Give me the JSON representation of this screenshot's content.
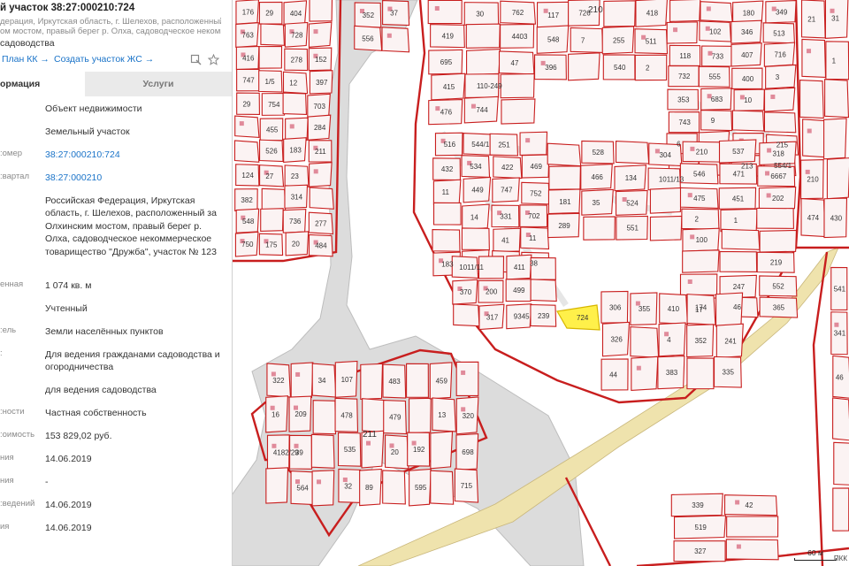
{
  "panel": {
    "title": "й участок 38:27:000210:724",
    "address_lines": [
      "дерация, Иркутская область, г. Шелехов, расположенный за",
      "ом мостом, правый берег р. Олха, садоводческое некоммерческ..."
    ],
    "type_line": "садоводства",
    "links": {
      "plan": "План КК →",
      "create": "Создать участок ЖС →"
    },
    "icons": {
      "bookmark": "bookmark-icon",
      "star": "star-icon"
    },
    "tabs": {
      "info": "ормация",
      "services": "Услуги"
    },
    "rows": [
      {
        "label": "",
        "value": "Объект недвижимости",
        "link": false
      },
      {
        "label": "",
        "value": "Земельный участок",
        "link": false
      },
      {
        "label": "омер:",
        "value": "38:27:000210:724",
        "link": true
      },
      {
        "label": "вартал:",
        "value": "38:27:000210",
        "link": true
      },
      {
        "label": "",
        "value": "Российская Федерация, Иркутская область, г. Шелехов, расположенный за Олхинским мостом, правый берег р. Олха, садоводческое некоммерческое товарищество \"Дружба\", участок № 123",
        "link": false
      },
      {
        "label": "енная",
        "value": "1 074 кв. м",
        "link": false
      },
      {
        "label": "",
        "value": "Учтенный",
        "link": false
      },
      {
        "label": "ель:",
        "value": "Земли населённых пунктов",
        "link": false
      },
      {
        "label": ":",
        "value": "Для ведения гражданами садоводства и огородничества",
        "link": false
      },
      {
        "label": "",
        "value": "для ведения садоводства",
        "link": false
      },
      {
        "label": "ности:",
        "value": "Частная собственность",
        "link": false
      },
      {
        "label": "оимость:",
        "value": "153 829,02 руб.",
        "link": false
      },
      {
        "label": "ния",
        "value": "14.06.2019",
        "link": false
      },
      {
        "label": "ния",
        "value": "-",
        "link": false
      },
      {
        "label": "ведений:",
        "value": "14.06.2019",
        "link": false
      },
      {
        "label": "ия",
        "value": "14.06.2019",
        "link": false
      }
    ]
  },
  "map": {
    "colors": {
      "parcel_border": "#c81e1e",
      "selected_fill": "#fff04a",
      "road": "#f0e2a6",
      "river": "#d8d8d8"
    },
    "quarters": [
      "210",
      "211"
    ],
    "selected_parcel": "724",
    "parcel_labels": [
      "176",
      "124",
      "1/5",
      "175",
      "183",
      "152",
      "277",
      "419",
      "110-249",
      "117",
      "255",
      "118",
      "102",
      "180",
      "213",
      "215",
      "183",
      "251",
      "469",
      "181",
      "134",
      "210",
      "174",
      "247",
      "219",
      "200",
      "239",
      "410",
      "241",
      "209",
      "107",
      "89",
      "192",
      "320",
      "210",
      "430",
      "339",
      "763",
      "382",
      "754",
      "404",
      "23",
      "397",
      "484",
      "695",
      "744",
      "548",
      "540",
      "732",
      "733",
      "346",
      "349",
      "554/1",
      "544/1",
      "422",
      "752",
      "289",
      "524",
      "546",
      "537",
      "46",
      "552",
      "317",
      "306",
      "4",
      "335",
      "39",
      "478",
      "483",
      "595",
      "698",
      "474",
      "541",
      "519",
      "416",
      "548",
      "455",
      "728",
      "314",
      "703",
      "352",
      "415",
      "762",
      "396",
      "418",
      "353",
      "555",
      "407",
      "513",
      "516",
      "534",
      "747",
      "702",
      "528",
      "551",
      "475",
      "471",
      "318",
      "365",
      "411",
      "326",
      "383",
      "322",
      "564",
      "535",
      "479",
      "459",
      "715",
      "31",
      "341",
      "327",
      "747",
      "750",
      "526",
      "278",
      "736",
      "284",
      "556",
      "476",
      "4403",
      "726",
      "511",
      "743",
      "683",
      "400",
      "716",
      "432",
      "449",
      "331",
      "11",
      "466",
      "304",
      "2",
      "451",
      "6667",
      "1011/11",
      "499",
      "44",
      "17",
      "16",
      "34",
      "32",
      "20",
      "13",
      "21",
      "1",
      "46",
      "42",
      "29",
      "29",
      "27",
      "12",
      "20",
      "211",
      "37",
      "30",
      "47",
      "7",
      "2",
      "6",
      "9",
      "10",
      "3",
      "11",
      "14",
      "41",
      "38",
      "35",
      "1011/13",
      "100",
      "1",
      "202",
      "370",
      "9345",
      "355",
      "352",
      "4182/29"
    ],
    "scale": "60 м",
    "attribution": "ПКК"
  }
}
